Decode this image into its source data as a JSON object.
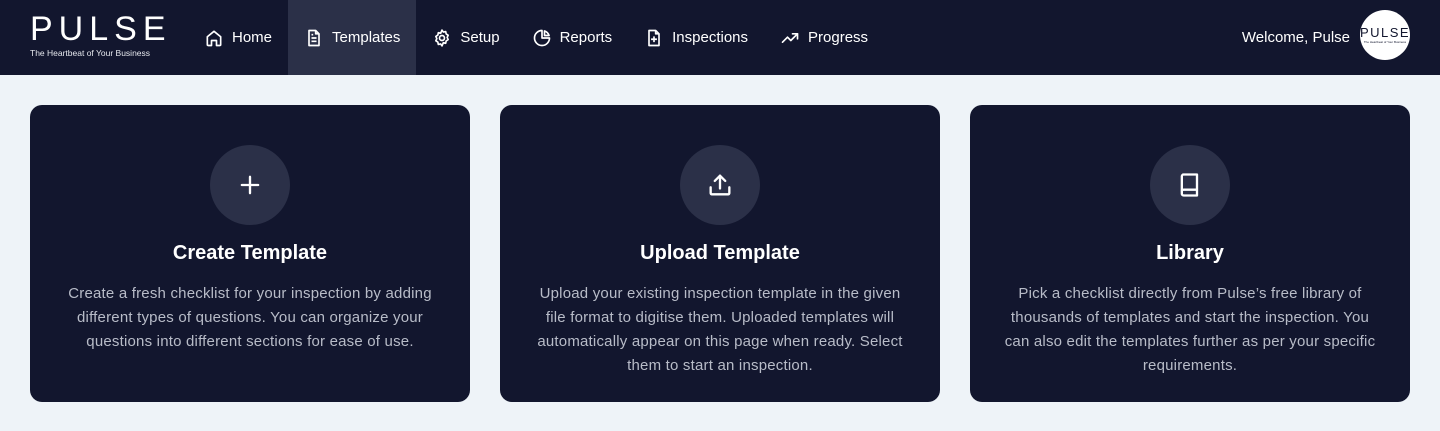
{
  "brand": {
    "name": "PULSE",
    "tagline": "The Heartbeat of Your Business"
  },
  "nav": {
    "items": [
      {
        "label": "Home",
        "icon": "home-icon",
        "active": false
      },
      {
        "label": "Templates",
        "icon": "document-icon",
        "active": true
      },
      {
        "label": "Setup",
        "icon": "gear-icon",
        "active": false
      },
      {
        "label": "Reports",
        "icon": "pie-chart-icon",
        "active": false
      },
      {
        "label": "Inspections",
        "icon": "file-plus-icon",
        "active": false
      },
      {
        "label": "Progress",
        "icon": "trending-up-icon",
        "active": false
      }
    ]
  },
  "user": {
    "welcome": "Welcome, Pulse",
    "avatar_text": "PULSE",
    "avatar_tagline": "The Heartbeat of Your Business"
  },
  "cards": [
    {
      "icon": "plus-icon",
      "title": "Create Template",
      "description": "Create a fresh checklist for your inspection by adding different types of questions. You can organize your questions into different sections for ease of use."
    },
    {
      "icon": "upload-icon",
      "title": "Upload Template",
      "description": "Upload your existing inspection template in the given file format to digitise them. Uploaded templates will automatically appear on this page when ready. Select them to start an inspection."
    },
    {
      "icon": "book-icon",
      "title": "Library",
      "description": "Pick a checklist directly from Pulse’s free library of thousands of templates and start the inspection. You can also edit the templates further as per your specific requirements."
    }
  ],
  "colors": {
    "navbar": "#12162e",
    "active_nav": "#2b3048",
    "page_background": "#eef3f8",
    "card_background": "#12162e",
    "card_icon_circle": "#2b3048",
    "card_text": "#b8bcc8"
  }
}
